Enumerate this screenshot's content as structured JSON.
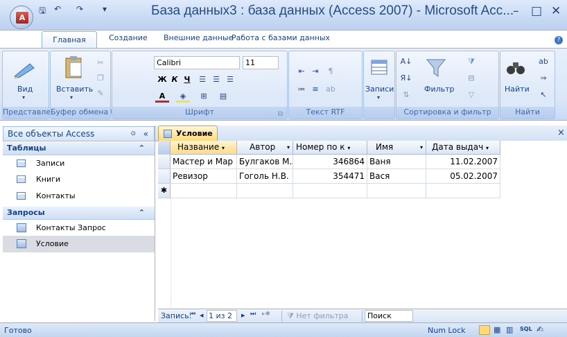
{
  "window": {
    "title": "База данных3 : база данных (Access 2007) - Microsoft Acc...",
    "app_logo_letter": "A",
    "qat": {
      "save": "🖫",
      "undo": "↶",
      "redo": "↷",
      "customize": "▾"
    },
    "controls": {
      "minimize": "–",
      "maximize": "□",
      "close": "✕"
    }
  },
  "ribbon_tabs": [
    "Главная",
    "Создание",
    "Внешние данные",
    "Работа с базами данных"
  ],
  "ribbon": {
    "groups": {
      "views": "Представления",
      "clipboard": "Буфер обмена",
      "font": "Шрифт",
      "rtf": "Текст RTF",
      "records": "Записи",
      "sort_filter": "Сортировка и фильтр",
      "find": "Найти"
    },
    "buttons": {
      "view": "Вид",
      "paste": "Вставить",
      "records": "Записи",
      "filter": "Фильтр",
      "find": "Найти"
    },
    "font": {
      "name": "Calibri",
      "size": "11",
      "bold": "Ж",
      "italic": "К",
      "underline": "Ч",
      "font_color": "А"
    },
    "launcher": "⧉"
  },
  "nav_pane": {
    "header": "Все объекты Access",
    "groups": [
      {
        "label": "Таблицы",
        "items": [
          "Записи",
          "Книги",
          "Контакты"
        ]
      },
      {
        "label": "Запросы",
        "items": [
          "Контакты Запрос",
          "Условие"
        ]
      }
    ],
    "selected_item": "Условие"
  },
  "document": {
    "tab_title": "Условие",
    "close": "×",
    "columns": [
      "Название",
      "Автор",
      "Номер по к",
      "Имя",
      "Дата выдач"
    ],
    "rows": [
      [
        "Мастер и Мар",
        "Булгаков М.А.",
        "346864",
        "Ваня",
        "11.02.2007"
      ],
      [
        "Ревизор",
        "Гоголь Н.В.",
        "354471",
        "Вася",
        "05.02.2007"
      ]
    ],
    "new_row_marker": "✱"
  },
  "record_nav": {
    "label": "Запись:",
    "first": "⏮",
    "prev": "◂",
    "position": "1 из 2",
    "next": "▸",
    "last": "⏭",
    "new": "▸✱",
    "filter": "Нет фильтра",
    "search": "Поиск"
  },
  "status": {
    "text": "Готово",
    "num_lock": "Num Lock"
  },
  "colors": {
    "accent": "#15428b",
    "ribbon_bg": "#dbe7f8",
    "active_tab": "#ffd97a"
  }
}
